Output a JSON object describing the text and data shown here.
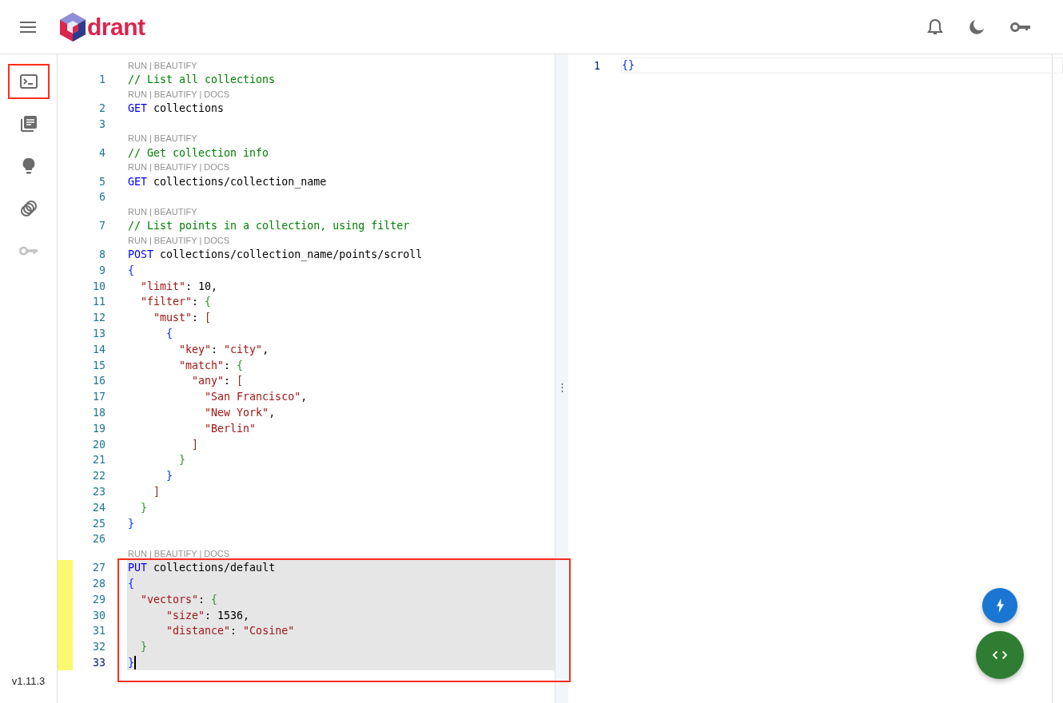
{
  "header": {
    "logo_text": "drant",
    "actions": [
      {
        "kind": "bell"
      },
      {
        "kind": "moon"
      },
      {
        "kind": "key"
      }
    ]
  },
  "sidebar": {
    "items": [
      {
        "kind": "console",
        "annotated": true,
        "disabled": false
      },
      {
        "kind": "docs",
        "annotated": false,
        "disabled": false
      },
      {
        "kind": "bulb",
        "annotated": false,
        "disabled": false
      },
      {
        "kind": "collections",
        "annotated": false,
        "disabled": false
      },
      {
        "kind": "key",
        "annotated": false,
        "disabled": true
      }
    ],
    "version": "v1.11.3"
  },
  "editor": {
    "blocks": [
      {
        "annotated": false,
        "lines": [
          {
            "number": "1",
            "lens": "RUN | BEAUTIFY",
            "tokens": [
              {
                "kind": "comment",
                "text": "// List all collections"
              }
            ]
          },
          {
            "number": "2",
            "lens": "RUN | BEAUTIFY | DOCS",
            "tokens": [
              {
                "kind": "method",
                "text": "GET"
              },
              {
                "kind": "plain",
                "text": " collections"
              }
            ]
          },
          {
            "number": "3"
          },
          {
            "number": "4",
            "lens": "RUN | BEAUTIFY",
            "tokens": [
              {
                "kind": "comment",
                "text": "// Get collection info"
              }
            ]
          },
          {
            "number": "5",
            "lens": "RUN | BEAUTIFY | DOCS",
            "tokens": [
              {
                "kind": "method",
                "text": "GET"
              },
              {
                "kind": "plain",
                "text": " collections/collection_name"
              }
            ]
          },
          {
            "number": "6"
          },
          {
            "number": "7",
            "lens": "RUN | BEAUTIFY",
            "tokens": [
              {
                "kind": "comment",
                "text": "// List points in a collection, using filter"
              }
            ]
          },
          {
            "number": "8",
            "lens": "RUN | BEAUTIFY | DOCS",
            "tokens": [
              {
                "kind": "method",
                "text": "POST"
              },
              {
                "kind": "plain",
                "text": " collections/collection_name/points/scroll"
              }
            ]
          },
          {
            "number": "9",
            "tokens": [
              {
                "kind": "bracket1",
                "text": "{"
              }
            ]
          },
          {
            "number": "10",
            "tokens": [
              {
                "kind": "key",
                "text": "  \"limit\""
              },
              {
                "kind": "plain",
                "text": ": 10,"
              }
            ]
          },
          {
            "number": "11",
            "tokens": [
              {
                "kind": "key",
                "text": "  \"filter\""
              },
              {
                "kind": "plain",
                "text": ": "
              },
              {
                "kind": "bracket2",
                "text": "{"
              }
            ]
          },
          {
            "number": "12",
            "tokens": [
              {
                "kind": "key",
                "text": "    \"must\""
              },
              {
                "kind": "plain",
                "text": ": "
              },
              {
                "kind": "bracket3",
                "text": "["
              }
            ]
          },
          {
            "number": "13",
            "tokens": [
              {
                "kind": "bracket1",
                "text": "      {"
              }
            ]
          },
          {
            "number": "14",
            "tokens": [
              {
                "kind": "key",
                "text": "        \"key\""
              },
              {
                "kind": "plain",
                "text": ": "
              },
              {
                "kind": "string",
                "text": "\"city\""
              },
              {
                "kind": "plain",
                "text": ","
              }
            ]
          },
          {
            "number": "15",
            "tokens": [
              {
                "kind": "key",
                "text": "        \"match\""
              },
              {
                "kind": "plain",
                "text": ": "
              },
              {
                "kind": "bracket2",
                "text": "{"
              }
            ]
          },
          {
            "number": "16",
            "tokens": [
              {
                "kind": "key",
                "text": "          \"any\""
              },
              {
                "kind": "plain",
                "text": ": "
              },
              {
                "kind": "bracket3",
                "text": "["
              }
            ]
          },
          {
            "number": "17",
            "tokens": [
              {
                "kind": "string",
                "text": "            \"San Francisco\""
              },
              {
                "kind": "plain",
                "text": ","
              }
            ]
          },
          {
            "number": "18",
            "tokens": [
              {
                "kind": "string",
                "text": "            \"New York\""
              },
              {
                "kind": "plain",
                "text": ","
              }
            ]
          },
          {
            "number": "19",
            "tokens": [
              {
                "kind": "string",
                "text": "            \"Berlin\""
              }
            ]
          },
          {
            "number": "20",
            "tokens": [
              {
                "kind": "bracket3",
                "text": "          ]"
              }
            ]
          },
          {
            "number": "21",
            "tokens": [
              {
                "kind": "bracket2",
                "text": "        }"
              }
            ]
          },
          {
            "number": "22",
            "tokens": [
              {
                "kind": "bracket1",
                "text": "      }"
              }
            ]
          },
          {
            "number": "23",
            "tokens": [
              {
                "kind": "bracket3",
                "text": "    ]"
              }
            ]
          },
          {
            "number": "24",
            "tokens": [
              {
                "kind": "bracket2",
                "text": "  }"
              }
            ]
          },
          {
            "number": "25",
            "tokens": [
              {
                "kind": "bracket1",
                "text": "}"
              }
            ]
          },
          {
            "number": "26"
          }
        ]
      },
      {
        "annotated": true,
        "lines": [
          {
            "number": "27",
            "lens": "RUN | BEAUTIFY | DOCS",
            "selected": true,
            "modified": true,
            "tokens": [
              {
                "kind": "method",
                "text": "PUT"
              },
              {
                "kind": "plain",
                "text": " collections/default"
              }
            ]
          },
          {
            "number": "28",
            "selected": true,
            "modified": true,
            "tokens": [
              {
                "kind": "bracket1",
                "text": "{"
              }
            ]
          },
          {
            "number": "29",
            "selected": true,
            "modified": true,
            "tokens": [
              {
                "kind": "key",
                "text": "  \"vectors\""
              },
              {
                "kind": "plain",
                "text": ": "
              },
              {
                "kind": "bracket2",
                "text": "{"
              }
            ]
          },
          {
            "number": "30",
            "selected": true,
            "modified": true,
            "tokens": [
              {
                "kind": "key",
                "text": "      \"size\""
              },
              {
                "kind": "plain",
                "text": ": 1536,"
              }
            ]
          },
          {
            "number": "31",
            "selected": true,
            "modified": true,
            "tokens": [
              {
                "kind": "key",
                "text": "      \"distance\""
              },
              {
                "kind": "plain",
                "text": ": "
              },
              {
                "kind": "string",
                "text": "\"Cosine\""
              }
            ]
          },
          {
            "number": "32",
            "selected": true,
            "modified": true,
            "tokens": [
              {
                "kind": "bracket2",
                "text": "  }"
              }
            ]
          },
          {
            "number": "33",
            "selected": true,
            "modified": true,
            "current": true,
            "tokens": [
              {
                "kind": "bracket1",
                "text": "}"
              }
            ]
          }
        ]
      }
    ]
  },
  "splitter": {
    "handle": "⋮"
  },
  "result": {
    "lines": [
      {
        "number": "1",
        "text": "{}"
      }
    ]
  },
  "fabs": [
    {
      "kind": "bolt",
      "color": "#1976d2"
    },
    {
      "kind": "code",
      "color": "#2e7d32"
    }
  ]
}
